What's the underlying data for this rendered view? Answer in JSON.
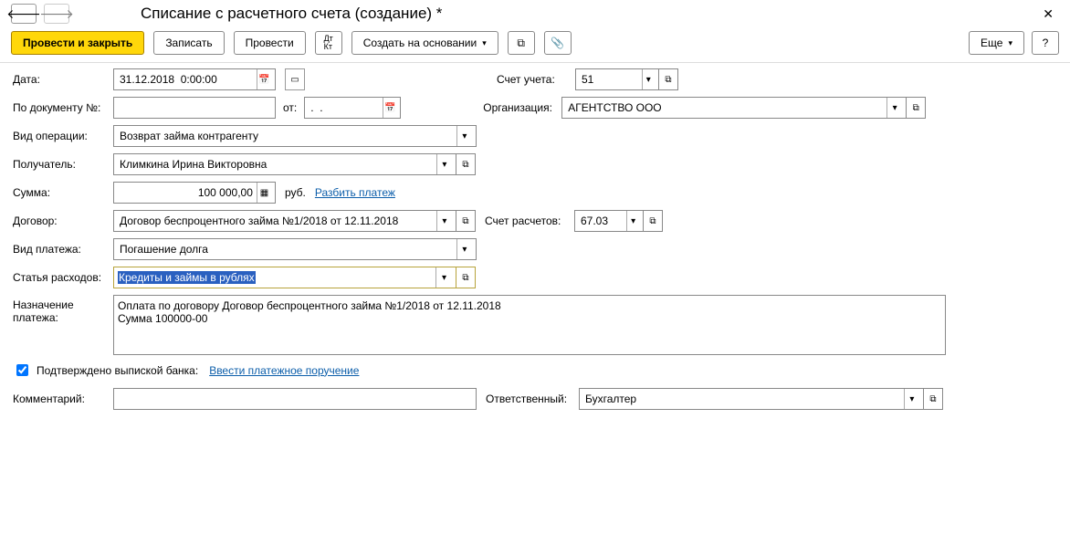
{
  "header": {
    "title": "Списание с расчетного счета (создание) *"
  },
  "toolbar": {
    "post_close": "Провести и закрыть",
    "save": "Записать",
    "post": "Провести",
    "create_based": "Создать на основании",
    "more": "Еще",
    "help": "?"
  },
  "fields": {
    "date_label": "Дата:",
    "date_value": "31.12.2018  0:00:00",
    "account_label": "Счет учета:",
    "account_value": "51",
    "docnum_label": "По документу №:",
    "docnum_value": "",
    "from_label": "от:",
    "from_value": ".  .",
    "org_label": "Организация:",
    "org_value": "АГЕНТСТВО ООО",
    "optype_label": "Вид операции:",
    "optype_value": "Возврат займа контрагенту",
    "recipient_label": "Получатель:",
    "recipient_value": "Климкина Ирина Викторовна",
    "sum_label": "Сумма:",
    "sum_value": "100 000,00",
    "currency": "руб.",
    "split_payment": "Разбить платеж",
    "contract_label": "Договор:",
    "contract_value": "Договор беспроцентного займа №1/2018 от 12.11.2018",
    "settlement_acct_label": "Счет расчетов:",
    "settlement_acct_value": "67.03",
    "paytype_label": "Вид платежа:",
    "paytype_value": "Погашение долга",
    "expense_item_label": "Статья расходов:",
    "expense_item_value": "Кредиты и займы в рублях",
    "purpose_label": "Назначение платежа:",
    "purpose_value": "Оплата по договору Договор беспроцентного займа №1/2018 от 12.11.2018\nСумма 100000-00",
    "confirmed_label": "Подтверждено выпиской банка:",
    "enter_payment_order": "Ввести платежное поручение",
    "comment_label": "Комментарий:",
    "comment_value": "",
    "responsible_label": "Ответственный:",
    "responsible_value": "Бухгалтер"
  }
}
